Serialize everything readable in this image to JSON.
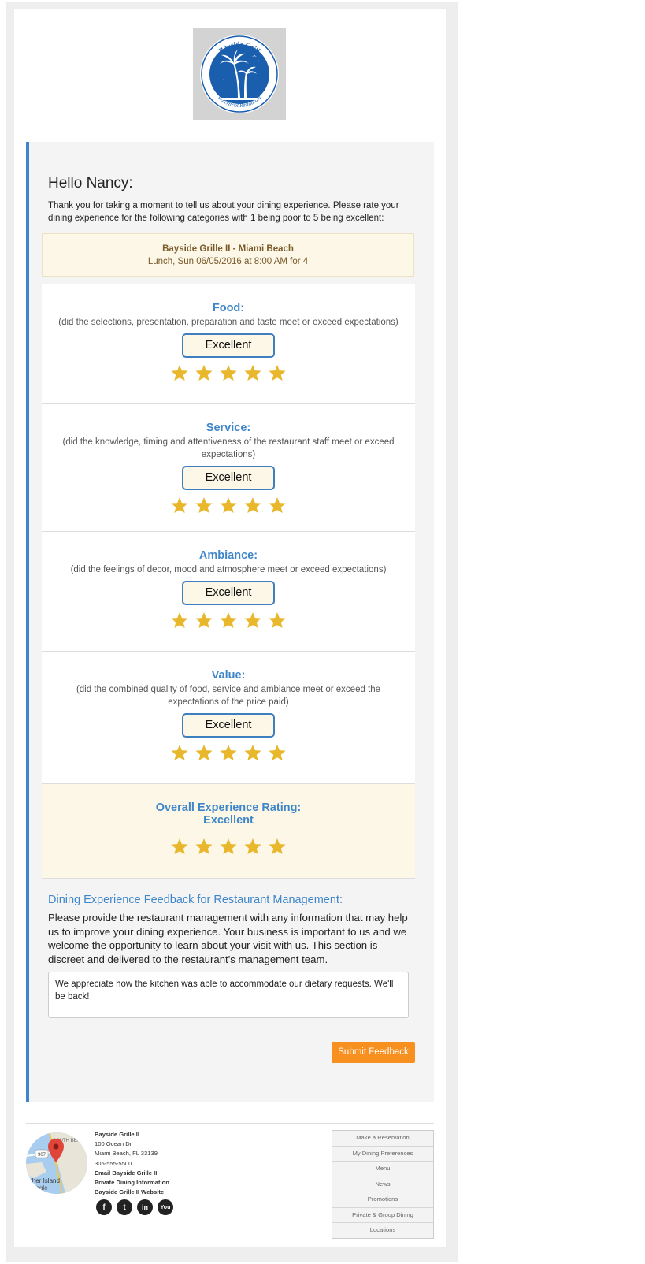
{
  "logo": {
    "name": "Bayside Grill",
    "tagline": "Waterfront Restaurant"
  },
  "greeting": "Hello Nancy:",
  "intro": "Thank you for taking a moment to tell us about your dining experience. Please rate your dining experience for the following categories with 1 being poor to 5 being excellent:",
  "reservation": {
    "restaurant": "Bayside Grille II - Miami Beach",
    "details": "Lunch, Sun 06/05/2016 at 8:00 AM for 4"
  },
  "ratings": [
    {
      "title": "Food:",
      "description": "(did the selections, presentation, preparation and taste meet or exceed expectations)",
      "value_label": "Excellent",
      "stars": 5
    },
    {
      "title": "Service:",
      "description": "(did the knowledge, timing and attentiveness of the restaurant staff meet or exceed expectations)",
      "value_label": "Excellent",
      "stars": 5
    },
    {
      "title": "Ambiance:",
      "description": "(did the feelings of decor, mood and atmosphere meet or exceed expectations)",
      "value_label": "Excellent",
      "stars": 5
    },
    {
      "title": "Value:",
      "description": "(did the combined quality of food, service and ambiance meet or exceed the expectations of the price paid)",
      "value_label": "Excellent",
      "stars": 5
    }
  ],
  "overall": {
    "title": "Overall Experience Rating:",
    "value": "Excellent",
    "stars": 5
  },
  "feedback": {
    "title": "Dining Experience Feedback for Restaurant Management:",
    "text": "Please provide the restaurant management with any information that may help us to improve your dining experience. Your business is important to us and we welcome the opportunity to learn about your visit with us. This section is discreet and delivered to the restaurant's management team.",
    "value": "We appreciate how the kitchen was able to accommodate our dietary requests. We'll be back!"
  },
  "submit_label": "Submit Feedback",
  "footer": {
    "map_labels": {
      "area": "SOUTH BEACH",
      "road": "907",
      "island": "isher Island",
      "brand": "oogle"
    },
    "name": "Bayside Grille II",
    "street": "100 Ocean Dr",
    "city": "Miami Beach, FL 33139",
    "phone": "305-555-5500",
    "email_link": "Email Bayside Grille II",
    "private_link": "Private Dining Information",
    "website_link": "Bayside Grille II Website",
    "social": [
      {
        "icon": "facebook-icon",
        "glyph": "f"
      },
      {
        "icon": "twitter-icon",
        "glyph": "t"
      },
      {
        "icon": "linkedin-icon",
        "glyph": "in"
      },
      {
        "icon": "youtube-icon",
        "glyph": "You"
      }
    ],
    "nav": [
      "Make a Reservation",
      "My Dining Preferences",
      "Menu",
      "News",
      "Promotions",
      "Private & Group Dining",
      "Locations"
    ]
  },
  "colors": {
    "accent": "#3f86c9",
    "star": "#e8b72b",
    "button": "#f7901e",
    "highlight_bg": "#fcf7e6"
  }
}
